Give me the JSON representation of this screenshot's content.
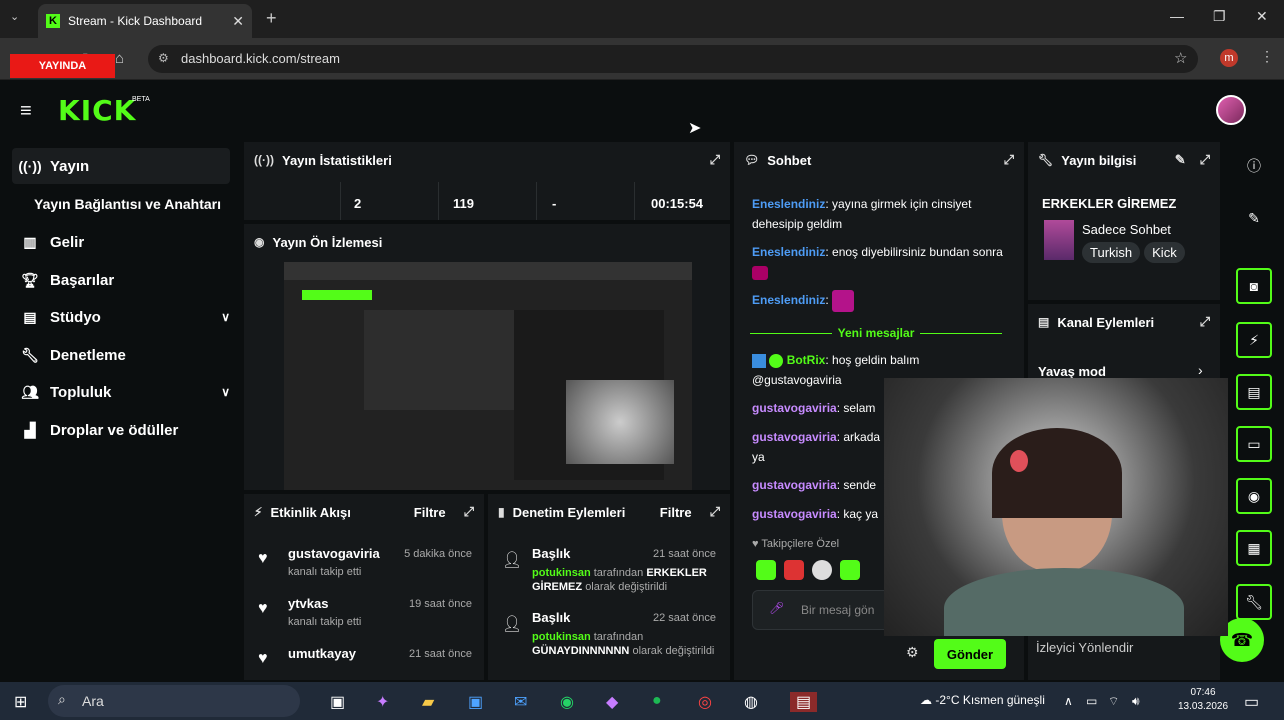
{
  "browser": {
    "tab_title": "Stream - Kick Dashboard",
    "url": "dashboard.kick.com/stream",
    "profile_letter": "m"
  },
  "brand": {
    "logo": "KICK",
    "beta": "BETA",
    "accent": "#53fc18"
  },
  "sidebar": {
    "items": [
      {
        "label": "Yayın",
        "icon": "broadcast-icon"
      },
      {
        "label": "Yayın Bağlantısı ve Anahtarı"
      },
      {
        "label": "Gelir",
        "icon": "chart-icon"
      },
      {
        "label": "Başarılar",
        "icon": "trophy-icon"
      },
      {
        "label": "Stüdyo",
        "icon": "studio-icon"
      },
      {
        "label": "Denetleme",
        "icon": "wrench-icon"
      },
      {
        "label": "Topluluk",
        "icon": "community-icon"
      },
      {
        "label": "Droplar ve ödüller",
        "icon": "drops-icon"
      }
    ]
  },
  "stats": {
    "title": "Yayın İstatistikleri",
    "live_badge": "YAYINDA",
    "viewers": "2",
    "followers": "119",
    "subs": "-",
    "duration": "00:15:54"
  },
  "preview": {
    "title": "Yayın Ön İzlemesi"
  },
  "activity": {
    "title": "Etkinlik Akışı",
    "filter": "Filtre",
    "items": [
      {
        "name": "gustavogaviria",
        "action": "kanalı takip etti",
        "time": "5 dakika önce"
      },
      {
        "name": "ytvkas",
        "action": "kanalı takip etti",
        "time": "19 saat önce"
      },
      {
        "name": "umutkayay",
        "action": "",
        "time": "21 saat önce"
      }
    ]
  },
  "moderation": {
    "title": "Denetim Eylemleri",
    "filter": "Filtre",
    "items": [
      {
        "title": "Başlık",
        "time": "21 saat önce",
        "user": "potukinsan",
        "mid": "tarafından",
        "value": "ERKEKLER GİREMEZ",
        "tail": "olarak değiştirildi"
      },
      {
        "title": "Başlık",
        "time": "22 saat önce",
        "user": "potukinsan",
        "mid": "tarafından",
        "value": "GÜNAYDINNNNNN",
        "tail": "olarak değiştirildi"
      }
    ]
  },
  "chat": {
    "title": "Sohbet",
    "messages": [
      {
        "user": "Eneslendiniz",
        "text": "yayına girmek için cinsiyet dehesipip geldim"
      },
      {
        "user": "Eneslendiniz",
        "text": "enoş diyebilirsiniz bundan sonra"
      },
      {
        "user": "Eneslendiniz",
        "text": ""
      }
    ],
    "new_messages": "Yeni mesajlar",
    "after": [
      {
        "user": "BotRix",
        "text": "hoş geldin balım @gustavogaviria"
      },
      {
        "user": "gustavogaviria",
        "text": "selam"
      },
      {
        "user": "gustavogaviria",
        "text": "arkada ya"
      },
      {
        "user": "gustavogaviria",
        "text": "sende"
      },
      {
        "user": "gustavogaviria",
        "text": "kaç ya"
      }
    ],
    "followers_only": "Takipçilere Özel",
    "placeholder": "Bir mesaj gön",
    "send": "Gönder"
  },
  "stream_info": {
    "title": "Yayın bilgisi",
    "stream_title": "ERKEKLER GİREMEZ",
    "category": "Sadece Sohbet",
    "tags": [
      "Turkish",
      "Kick"
    ]
  },
  "channel_actions": {
    "title": "Kanal Eylemleri",
    "slow_mode": "Yavaş mod",
    "viewer_redirect": "İzleyici Yönlendir"
  },
  "taskbar": {
    "search": "Ara",
    "weather": "-2°C  Kısmen güneşli",
    "time": "07:46",
    "date": "13.03.2026"
  }
}
